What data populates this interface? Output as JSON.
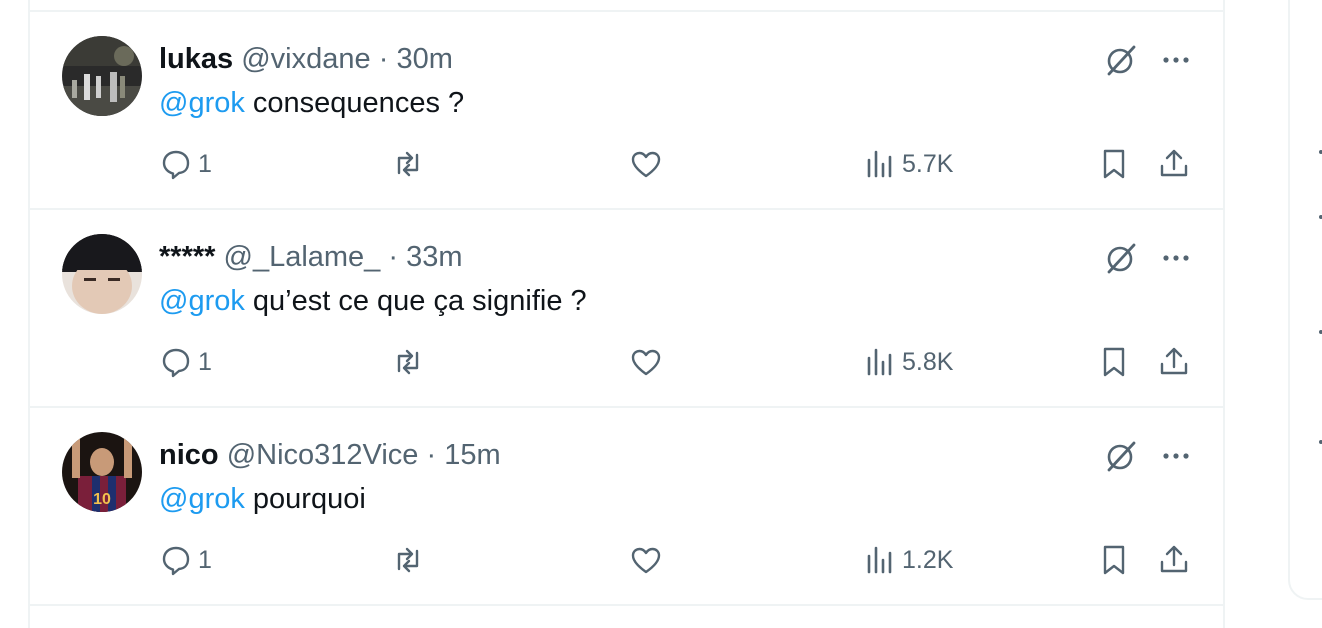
{
  "colors": {
    "mention": "#1d9bf0",
    "secondary_text": "#536471",
    "divider": "#eff3f4"
  },
  "tweets": [
    {
      "name": "lukas",
      "handle": "@vixdane",
      "separator": "·",
      "time": "30m",
      "mention": "@grok",
      "text": " consequences ?",
      "replies": "1",
      "views": "5.7K"
    },
    {
      "name": "*****",
      "handle": "@_Lalame_",
      "separator": "·",
      "time": "33m",
      "mention": "@grok",
      "text": " qu’est ce que ça signifie ?",
      "replies": "1",
      "views": "5.8K"
    },
    {
      "name": "nico",
      "handle": "@Nico312Vice",
      "separator": "·",
      "time": "15m",
      "mention": "@grok",
      "text": " pourquoi",
      "replies": "1",
      "views": "1.2K"
    }
  ],
  "icons": {
    "grok": "grok-icon",
    "more": "more-icon",
    "reply": "reply-icon",
    "retweet": "retweet-icon",
    "like": "heart-icon",
    "views": "views-icon",
    "bookmark": "bookmark-icon",
    "share": "share-icon"
  }
}
